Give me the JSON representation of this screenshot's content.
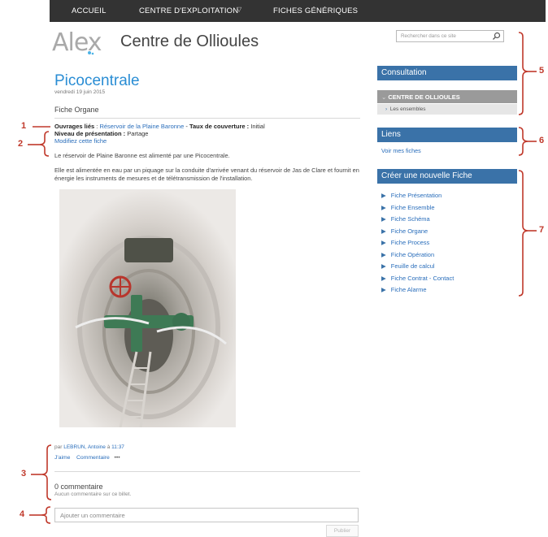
{
  "topnav": {
    "items": [
      "ACCUEIL",
      "CENTRE D'EXPLOITATION",
      "FICHES GÉNÉRIQUES"
    ]
  },
  "site": {
    "logo_text": "Alex",
    "title": "Centre de Ollioules"
  },
  "post": {
    "title": "Picocentrale",
    "date": "vendredi 19 juin 2015",
    "content_type": "Fiche Organe",
    "ouvrages_label": "Ouvrages liés",
    "ouvrages_value": "Réservoir de la Plaine Baronne",
    "taux_label": "Taux de couverture :",
    "taux_value": "Initial",
    "niveau_label": "Niveau de présentation :",
    "niveau_value": "Partage",
    "modify_link": "Modifiez cette fiche",
    "para1": "Le réservoir de Plaine Baronne est alimenté par une Picocentrale.",
    "para2": "Elle est alimentée en eau par un piquage sur la conduite d'arrivée venant du réservoir de Jas de Clare et fournit en énergie les instruments de mesures et de télétransmission de l'installation."
  },
  "footer": {
    "by_prefix": "par",
    "author": "LEBRUN, Antoine",
    "at": "à",
    "time": "11:37",
    "like": "J'aime",
    "comment": "Commentaire",
    "more": "•••",
    "comment_count": "0 commentaire",
    "no_comment": "Aucun commentaire sur ce billet.",
    "comment_placeholder": "Ajouter un commentaire",
    "publish": "Publier"
  },
  "sidebar": {
    "search_placeholder": "Rechercher dans ce site",
    "consultation": "Consultation",
    "centre": "CENTRE DE OLLIOULES",
    "ensembles": "Les ensembles",
    "liens": "Liens",
    "mes_fiches": "Voir mes fiches",
    "creer": "Créer une nouvelle Fiche",
    "fiches": [
      "Fiche Présentation",
      "Fiche Ensemble",
      "Fiche Schéma",
      "Fiche Organe",
      "Fiche Process",
      "Fiche Opération",
      "Feuille de calcul",
      "Fiche Contrat - Contact",
      "Fiche Alarme"
    ]
  },
  "annotations": [
    "1",
    "2",
    "3",
    "4",
    "5",
    "6",
    "7"
  ],
  "colors": {
    "accent": "#3a72a8",
    "link": "#2a6ebb",
    "title": "#2a8dd4",
    "annotation": "#c0392b"
  }
}
